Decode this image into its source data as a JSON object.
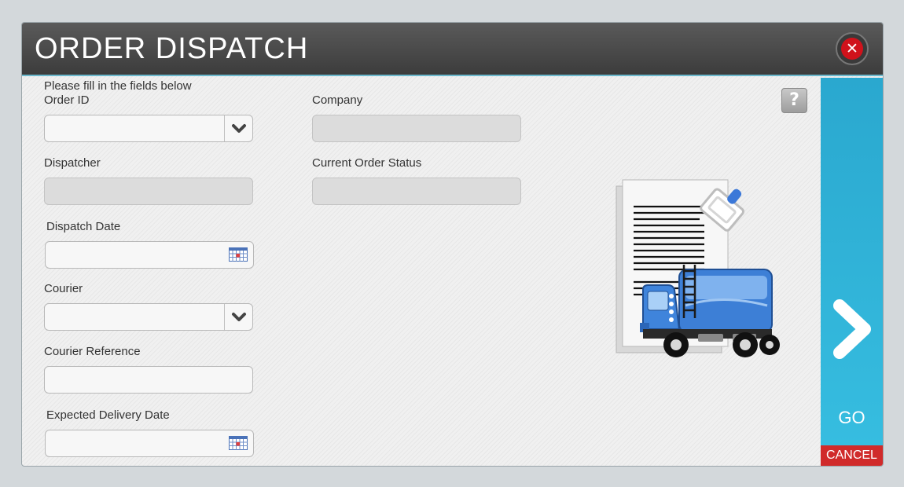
{
  "window": {
    "title": "ORDER DISPATCH",
    "close_icon": "close-icon",
    "help_label": "?"
  },
  "form": {
    "instructions": "Please fill in the fields below",
    "order_id": {
      "label": "Order ID",
      "value": ""
    },
    "company": {
      "label": "Company",
      "value": ""
    },
    "dispatcher": {
      "label": "Dispatcher",
      "value": ""
    },
    "current_order_status": {
      "label": "Current Order Status",
      "value": ""
    },
    "dispatch_date": {
      "label": "Dispatch Date",
      "value": ""
    },
    "courier": {
      "label": "Courier",
      "value": ""
    },
    "courier_reference": {
      "label": "Courier Reference",
      "value": ""
    },
    "expected_delivery_date": {
      "label": "Expected Delivery Date",
      "value": ""
    }
  },
  "actions": {
    "go_label": "GO",
    "cancel_label": "CANCEL"
  },
  "colors": {
    "title_bar": "#474747",
    "go_panel": "#31b4da",
    "cancel": "#d02a2a",
    "close": "#d0121b"
  }
}
